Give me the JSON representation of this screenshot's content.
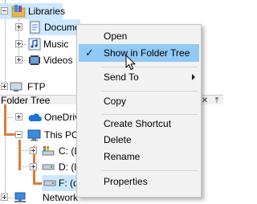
{
  "top_tree": {
    "libraries": "Libraries",
    "documents": "Documents",
    "music": "Music",
    "videos": "Videos",
    "ftp": "FTP"
  },
  "folder_tree_panel": {
    "title": "Folder Tree",
    "close_glyph": "✕",
    "pin_glyph": "⤒",
    "items": {
      "onedrive": "OneDrive",
      "this_pc": "This PC",
      "drive_c": "C: (L",
      "drive_d": "D: (li",
      "drive_f": "F: (d",
      "network": "Network"
    }
  },
  "context_menu": {
    "items": [
      {
        "label": "Open"
      },
      {
        "label": "Show in Folder Tree",
        "checked": true,
        "highlighted": true
      },
      {
        "label": "Send To",
        "submenu": true
      },
      {
        "label": "Copy"
      },
      {
        "label": "Create Shortcut"
      },
      {
        "label": "Delete"
      },
      {
        "label": "Rename"
      },
      {
        "label": "Properties"
      }
    ],
    "check_glyph": "✓"
  },
  "colors": {
    "selection": "#cce8ff",
    "menu_highlight": "#91c9f7",
    "tree_path_orange": "#e07a3a",
    "menu_background": "#f2f2f2"
  }
}
